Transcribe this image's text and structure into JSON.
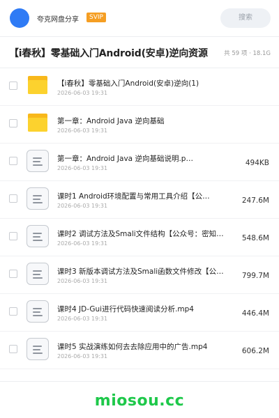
{
  "header": {
    "share_name": "夸克网盘分享",
    "badge": "SVIP",
    "search_label": "搜索",
    "avatar_color": "#2f7bf5",
    "badge_color": "#f59e23"
  },
  "share": {
    "title": "【i春秋】零基础入门Android(安卓)逆向资源",
    "meta": "共 59 项 · 18.1G"
  },
  "files": [
    {
      "type": "folder",
      "name": "【i春秋】零基础入门Android(安卓)逆向(1)",
      "date": "2026-06-03 19:31",
      "size": ""
    },
    {
      "type": "folder",
      "name": "第一章：Android Java 逆向基础",
      "date": "2026-06-03 19:31",
      "size": ""
    },
    {
      "type": "file",
      "name": "第一章：Android Java 逆向基础说明.p…",
      "date": "2026-06-03 19:31",
      "size": "494KB"
    },
    {
      "type": "file",
      "name": "课时1 Android环境配置与常用工具介绍【公…",
      "date": "2026-06-03 19:31",
      "size": "247.6M"
    },
    {
      "type": "file",
      "name": "课时2 调试方法及Smali文件结构【公众号：密知…",
      "date": "2026-06-03 19:31",
      "size": "548.6M"
    },
    {
      "type": "file",
      "name": "课时3 新版本调试方法及Smali函数文件修改【公…",
      "date": "2026-06-03 19:31",
      "size": "799.7M"
    },
    {
      "type": "file",
      "name": "课时4 JD-Gui进行代码快速阅读分析.mp4",
      "date": "2026-06-03 19:31",
      "size": "446.4M"
    },
    {
      "type": "file",
      "name": "课时5 实战演练如何去去除应用中的广告.mp4",
      "date": "2026-06-03 19:31",
      "size": "606.2M"
    }
  ],
  "watermark": {
    "text": "miosou.cc",
    "color": "#1ec84a"
  }
}
